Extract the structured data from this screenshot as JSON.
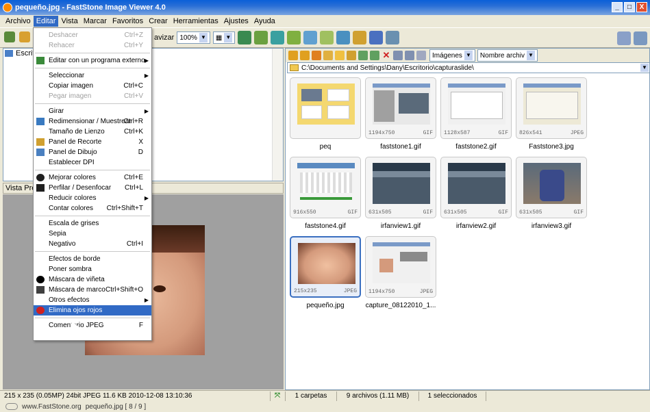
{
  "window": {
    "title": "pequeño.jpg - FastStone Image Viewer 4.0",
    "buttons": [
      "_",
      "□",
      "X"
    ]
  },
  "menubar": {
    "items": [
      "Archivo",
      "Editar",
      "Vista",
      "Marcar",
      "Favoritos",
      "Crear",
      "Herramientas",
      "Ajustes",
      "Ayuda"
    ],
    "active_index": 1
  },
  "toolbar": {
    "zoom_label": "avizar",
    "zoom_value": "100%"
  },
  "left_panel": {
    "tree_label": "Escrit",
    "preview_header": "Vista Pre"
  },
  "edit_menu": {
    "items": [
      {
        "label": "Deshacer",
        "shortcut": "Ctrl+Z",
        "disabled": true
      },
      {
        "label": "Rehacer",
        "shortcut": "Ctrl+Y",
        "disabled": true
      },
      {
        "sep": true
      },
      {
        "label": "Editar con un programa externo",
        "submenu": true,
        "icon": "external-edit-icon"
      },
      {
        "sep": true
      },
      {
        "label": "Seleccionar",
        "submenu": true
      },
      {
        "label": "Copiar imagen",
        "shortcut": "Ctrl+C"
      },
      {
        "label": "Pegar imagen",
        "shortcut": "Ctrl+V",
        "disabled": true
      },
      {
        "sep": true
      },
      {
        "label": "Girar",
        "submenu": true
      },
      {
        "label": "Redimensionar / Muestrear",
        "shortcut": "Ctrl+R",
        "icon": "resize-icon"
      },
      {
        "label": "Tamaño de Lienzo",
        "shortcut": "Ctrl+K"
      },
      {
        "label": "Panel de Recorte",
        "shortcut": "X",
        "icon": "crop-icon"
      },
      {
        "label": "Panel de Dibujo",
        "shortcut": "D",
        "icon": "draw-icon"
      },
      {
        "label": "Establecer DPI"
      },
      {
        "sep": true
      },
      {
        "label": "Mejorar colores",
        "shortcut": "Ctrl+E",
        "icon": "color-icon"
      },
      {
        "label": "Perfilar / Desenfocar",
        "shortcut": "Ctrl+L",
        "icon": "sharpen-icon"
      },
      {
        "label": "Reducir colores",
        "submenu": true
      },
      {
        "label": "Contar colores",
        "shortcut": "Ctrl+Shift+T"
      },
      {
        "sep": true
      },
      {
        "label": "Escala de grises"
      },
      {
        "label": "Sepia"
      },
      {
        "label": "Negativo",
        "shortcut": "Ctrl+I"
      },
      {
        "sep": true
      },
      {
        "label": "Efectos de borde"
      },
      {
        "label": "Poner sombra"
      },
      {
        "label": "Máscara de viñeta",
        "icon": "vignette-icon"
      },
      {
        "label": "Máscara de marco",
        "shortcut": "Ctrl+Shift+O",
        "icon": "frame-icon"
      },
      {
        "label": "Otros efectos",
        "submenu": true
      },
      {
        "label": "Elimina ojos rojos",
        "highlighted": true,
        "icon": "red-eye-icon"
      },
      {
        "sep": true
      },
      {
        "label": "Comentario JPEG",
        "shortcut": "F"
      }
    ]
  },
  "browser": {
    "path": "C:\\Documents and Settings\\Dany\\Escritorio\\capturaslide\\",
    "filter_value": "Imágenes",
    "sort_value": "Nombre archiv",
    "thumbnails": [
      {
        "name": "peq",
        "dims": "",
        "fmt": "",
        "kind": "folder"
      },
      {
        "name": "faststone1.gif",
        "dims": "1194x750",
        "fmt": "GIF",
        "kind": "screen"
      },
      {
        "name": "faststone2.gif",
        "dims": "1128x587",
        "fmt": "GIF",
        "kind": "screen2"
      },
      {
        "name": "Faststone3.jpg",
        "dims": "826x541",
        "fmt": "JPEG",
        "kind": "screen3"
      },
      {
        "name": "faststone4.gif",
        "dims": "916x550",
        "fmt": "GIF",
        "kind": "screen4"
      },
      {
        "name": "irfanview1.gif",
        "dims": "631x505",
        "fmt": "GIF",
        "kind": "crowd"
      },
      {
        "name": "irfanview2.gif",
        "dims": "631x505",
        "fmt": "GIF",
        "kind": "crowd"
      },
      {
        "name": "irfanview3.gif",
        "dims": "631x505",
        "fmt": "GIF",
        "kind": "people"
      },
      {
        "name": "pequeño.jpg",
        "dims": "215x235",
        "fmt": "JPEG",
        "kind": "face",
        "selected": true
      },
      {
        "name": "capture_08122010_1...",
        "dims": "1194x750",
        "fmt": "JPEG",
        "kind": "screen5"
      }
    ]
  },
  "status": {
    "image_info": "215 x 235 (0.05MP)  24bit JPEG  11.6 KB  2010-12-08 13:10:36",
    "folders": "1 carpetas",
    "files": "9 archivos (1.11 MB)",
    "selected": "1 seleccionados"
  },
  "bottom": {
    "site": "www.FastStone.org",
    "file_position": "pequeño.jpg [ 8 / 9 ]"
  },
  "colors": {
    "title_blue": "#0a5fd8",
    "menu_highlight": "#316ac5",
    "selection_border": "#3a6fc0"
  }
}
